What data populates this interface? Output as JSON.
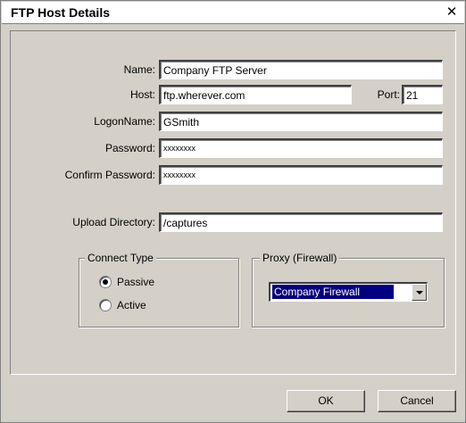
{
  "window": {
    "title": "FTP Host Details",
    "close_glyph": "✕"
  },
  "form": {
    "name_label": "Name:",
    "name_value": "Company FTP Server",
    "host_label": "Host:",
    "host_value": "ftp.wherever.com",
    "port_label": "Port:",
    "port_value": "21",
    "logon_label": "LogonName:",
    "logon_value": "GSmith",
    "password_label": "Password:",
    "password_value": "xxxxxxxx",
    "confirm_label": "Confirm Password:",
    "confirm_value": "xxxxxxxx",
    "upload_label": "Upload Directory:",
    "upload_value": "/captures"
  },
  "connect_type": {
    "legend": "Connect Type",
    "options": [
      {
        "label": "Passive",
        "selected": true
      },
      {
        "label": "Active",
        "selected": false
      }
    ]
  },
  "proxy": {
    "legend": "Proxy (Firewall)",
    "selected": "Company Firewall"
  },
  "buttons": {
    "ok": "OK",
    "cancel": "Cancel"
  }
}
